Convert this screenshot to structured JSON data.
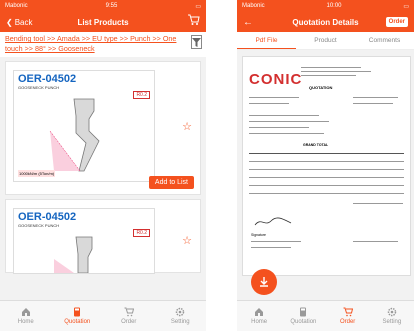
{
  "left_screen": {
    "status": {
      "carrier": "Mabonic",
      "time": "9:55"
    },
    "nav": {
      "back_label": "Back",
      "title": "List Products"
    },
    "breadcrumb": "Bending tool >> Amada >> EU type >> Punch >> One touch >> 88° >> Gooseneck",
    "products": [
      {
        "code": "OER-04502",
        "subtitle": "GOOSENECK PUNCH",
        "badge": "R0.2",
        "spec": "1000kN/m (5Ton/m)",
        "add_label": "Add to List"
      },
      {
        "code": "OER-04502",
        "subtitle": "GOOSENECK PUNCH",
        "badge": "R0.2"
      }
    ]
  },
  "right_screen": {
    "status": {
      "carrier": "Mabonic",
      "time": "10:00"
    },
    "nav": {
      "title": "Quotation Details",
      "order_label": "Order"
    },
    "segments": [
      "Pdf File",
      "Product",
      "Comments"
    ],
    "document": {
      "logo": "CONIC",
      "heading": "QUOTATION",
      "total": "GRAND TOTAL",
      "sign_label": "Signature"
    }
  },
  "tabs": [
    "Home",
    "Quotation",
    "Order",
    "Setting"
  ],
  "colors": {
    "accent": "#f4511e",
    "badge": "#d32f2f",
    "code": "#1565c0"
  }
}
